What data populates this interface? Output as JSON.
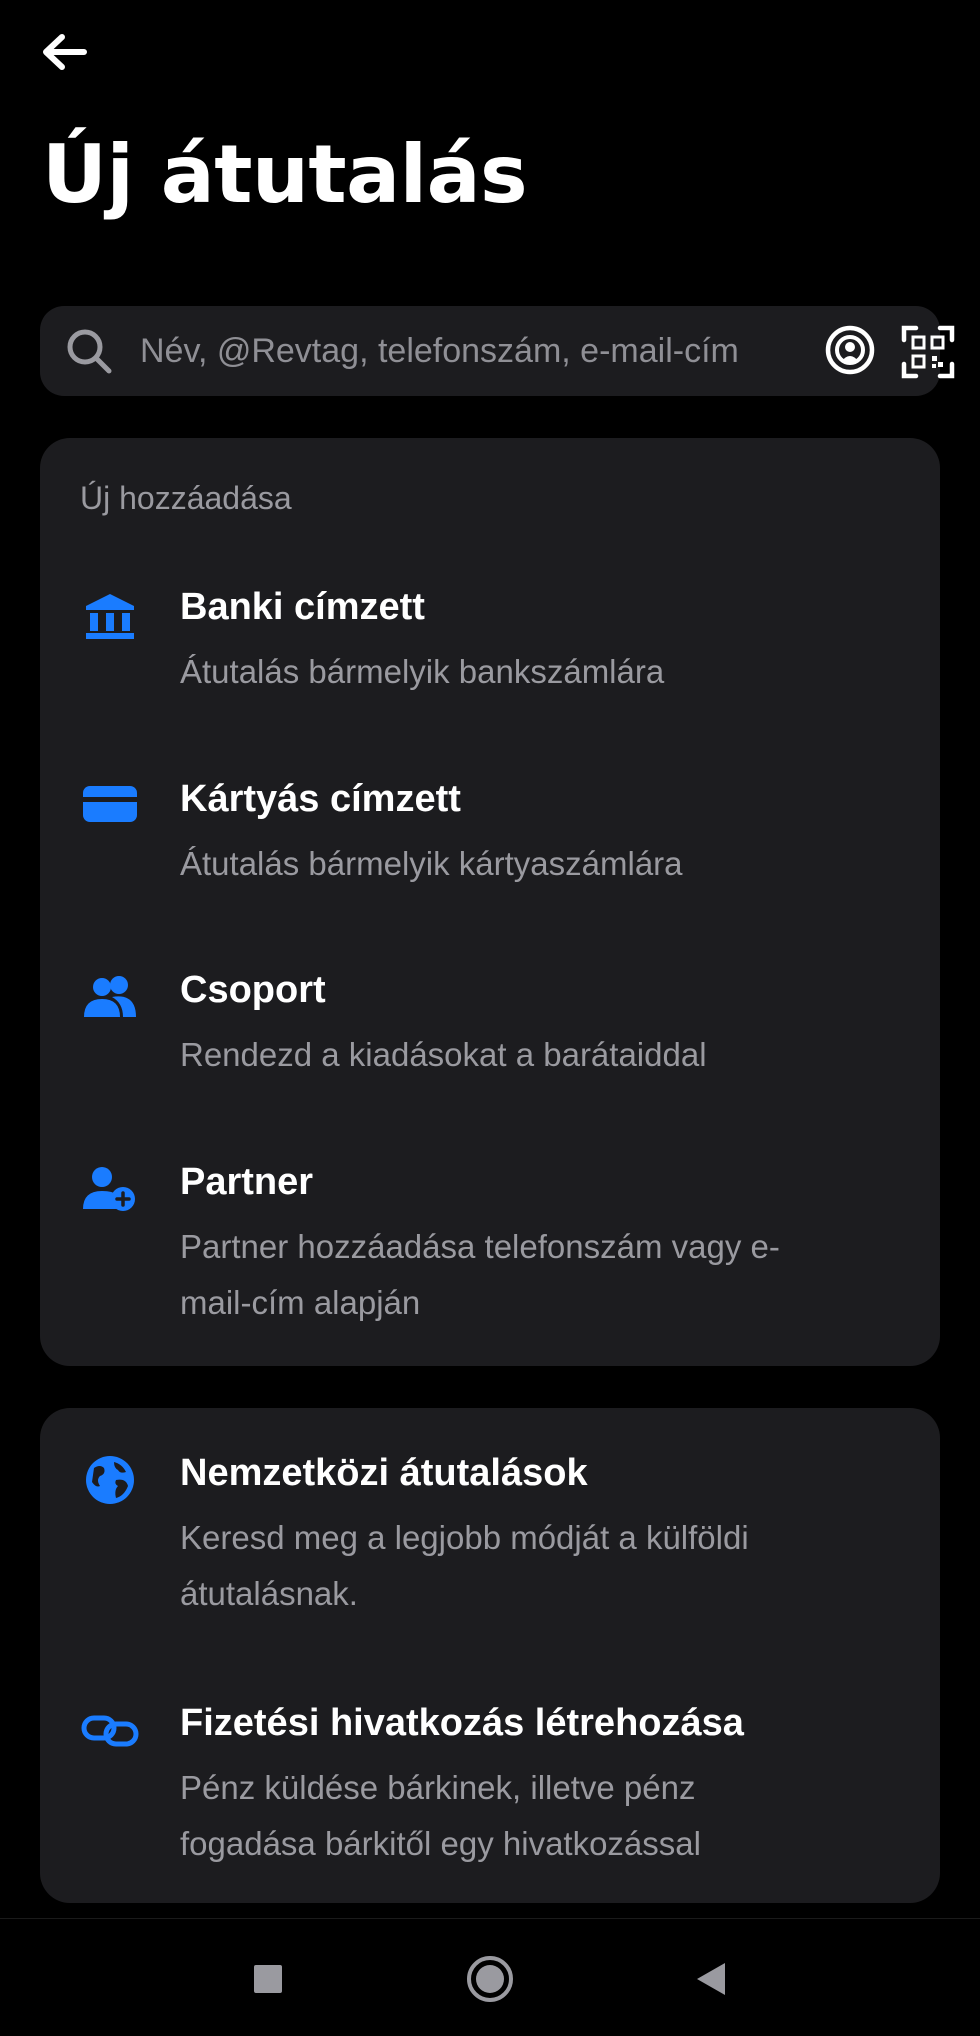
{
  "header": {
    "back_icon": "arrow-left-icon",
    "title": "Új átutalás"
  },
  "search": {
    "placeholder": "Név, @Revtag, telefonszám, e-mail-cím",
    "icons": [
      "search-icon",
      "nearby-icon",
      "qr-code-icon"
    ]
  },
  "add_new": {
    "label": "Új hozzáadása",
    "items": [
      {
        "icon": "bank-icon",
        "title": "Banki címzett",
        "subtitle": "Átutalás bármelyik bankszámlára"
      },
      {
        "icon": "card-icon",
        "title": "Kártyás címzett",
        "subtitle": "Átutalás bármelyik kártyaszámlára"
      },
      {
        "icon": "group-icon",
        "title": "Csoport",
        "subtitle": "Rendezd a kiadásokat a barátaiddal"
      },
      {
        "icon": "add-person-icon",
        "title": "Partner",
        "subtitle": "Partner hozzáadása telefonszám vagy e-mail-cím alapján"
      }
    ]
  },
  "other": {
    "items": [
      {
        "icon": "globe-icon",
        "title": "Nemzetközi átutalások",
        "subtitle": "Keresd meg a legjobb módját a külföldi átutalásnak."
      },
      {
        "icon": "link-icon",
        "title": "Fizetési hivatkozás létrehozása",
        "subtitle": "Pénz küldése bárkinek, illetve pénz fogadása bárkitől egy hivatkozással"
      }
    ]
  },
  "navbar": {
    "buttons": [
      "recents-icon",
      "home-icon",
      "back-icon"
    ]
  },
  "colors": {
    "background": "#000000",
    "card": "#1c1c1f",
    "accent": "#1a7cff",
    "secondary_text": "#9a9aa0"
  }
}
